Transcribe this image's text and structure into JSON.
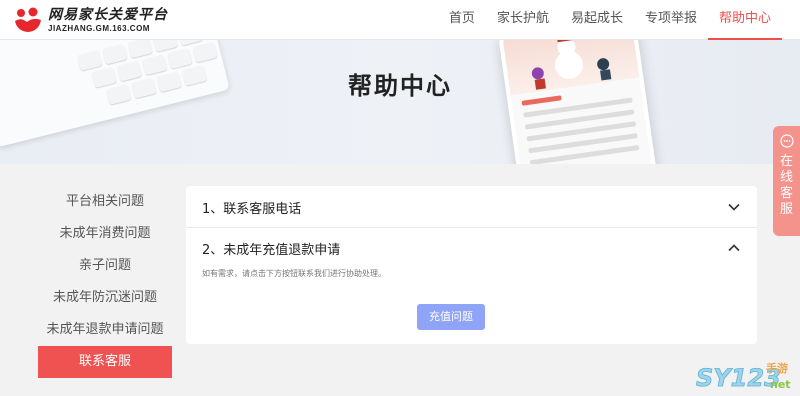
{
  "header": {
    "logo_cn": "网易家长关爱平台",
    "logo_en": "JIAZHANG.GM.163.COM",
    "nav": [
      {
        "label": "首页"
      },
      {
        "label": "家长护航"
      },
      {
        "label": "易起成长"
      },
      {
        "label": "专项举报"
      },
      {
        "label": "帮助中心"
      }
    ],
    "active_nav": "帮助中心"
  },
  "banner": {
    "title": "帮助中心"
  },
  "sidebar": {
    "items": [
      {
        "label": "平台相关问题"
      },
      {
        "label": "未成年消费问题"
      },
      {
        "label": "亲子问题"
      },
      {
        "label": "未成年防沉迷问题"
      },
      {
        "label": "未成年退款申请问题"
      },
      {
        "label": "联系客服"
      }
    ],
    "active": "联系客服"
  },
  "faq": {
    "items": [
      {
        "title": "1、联系客服电话",
        "expanded": false
      },
      {
        "title": "2、未成年充值退款申请",
        "expanded": true,
        "answer": "如有需求，请点击下方按钮联系我们进行协助处理。",
        "button": "充值问题"
      }
    ]
  },
  "float_service": {
    "label": "在线客服"
  },
  "watermark": {
    "text": "SY123手游net"
  },
  "colors": {
    "accent": "#f04d4d",
    "button": "#8fa4f6",
    "float": "#f3938c"
  }
}
